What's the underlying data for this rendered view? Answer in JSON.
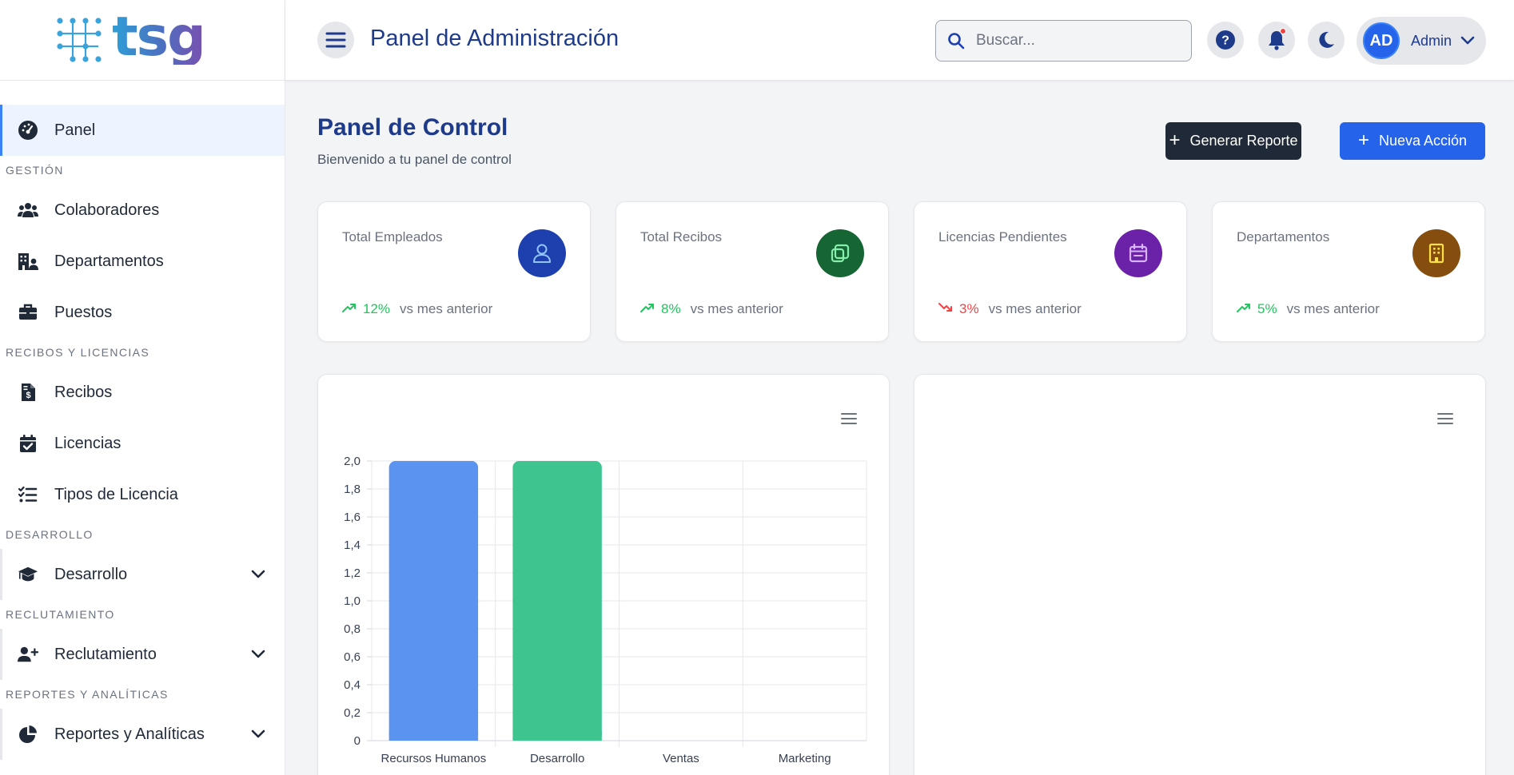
{
  "brand": {
    "logo_text": "tsg"
  },
  "sidebar": {
    "items": [
      {
        "type": "item",
        "label": "Panel",
        "icon": "gauge-icon",
        "active": true
      },
      {
        "type": "section",
        "label": "GESTIÓN"
      },
      {
        "type": "item",
        "label": "Colaboradores",
        "icon": "users-icon"
      },
      {
        "type": "item",
        "label": "Departamentos",
        "icon": "building-user-icon"
      },
      {
        "type": "item",
        "label": "Puestos",
        "icon": "briefcase-icon"
      },
      {
        "type": "section",
        "label": "RECIBOS Y LICENCIAS"
      },
      {
        "type": "item",
        "label": "Recibos",
        "icon": "file-invoice-dollar-icon"
      },
      {
        "type": "item",
        "label": "Licencias",
        "icon": "calendar-check-icon"
      },
      {
        "type": "item",
        "label": "Tipos de Licencia",
        "icon": "list-check-icon"
      },
      {
        "type": "section",
        "label": "DESARROLLO"
      },
      {
        "type": "group",
        "label": "Desarrollo",
        "icon": "graduation-cap-icon"
      },
      {
        "type": "section",
        "label": "RECLUTAMIENTO"
      },
      {
        "type": "group",
        "label": "Reclutamiento",
        "icon": "user-plus-icon"
      },
      {
        "type": "section",
        "label": "REPORTES Y ANALÍTICAS"
      },
      {
        "type": "group",
        "label": "Reportes y Analíticas",
        "icon": "chart-pie-icon"
      }
    ]
  },
  "header": {
    "title": "Panel de Administración",
    "search_placeholder": "Buscar...",
    "user": {
      "initials": "AD",
      "name": "Admin"
    }
  },
  "main": {
    "title": "Panel de Control",
    "subtitle": "Bienvenido a tu panel de control",
    "actions": {
      "report_label": "Generar Reporte",
      "new_action_label": "Nueva Acción"
    },
    "stats": [
      {
        "label": "Total Empleados",
        "trend": "12%",
        "direction": "up",
        "suffix": "vs mes anterior",
        "icon": "user-icon",
        "color": "#1e40af",
        "icon_color": "#93c5fd"
      },
      {
        "label": "Total Recibos",
        "trend": "8%",
        "direction": "up",
        "suffix": "vs mes anterior",
        "icon": "receipt-icon",
        "color": "#166534",
        "icon_color": "#86efac"
      },
      {
        "label": "Licencias Pendientes",
        "trend": "3%",
        "direction": "down",
        "suffix": "vs mes anterior",
        "icon": "calendar-icon",
        "color": "#6b21a8",
        "icon_color": "#d8b4fe"
      },
      {
        "label": "Departamentos",
        "trend": "5%",
        "direction": "up",
        "suffix": "vs mes anterior",
        "icon": "building-icon",
        "color": "#854d0e",
        "icon_color": "#fde047"
      }
    ]
  },
  "chart_data": {
    "type": "bar",
    "categories": [
      "Recursos Humanos",
      "Desarrollo",
      "Ventas",
      "Marketing"
    ],
    "values": [
      2,
      2,
      0,
      0
    ],
    "colors": [
      "#5b93f0",
      "#3ec48f"
    ],
    "ylim": [
      0,
      2
    ],
    "yticks": [
      "0",
      "0,2",
      "0,4",
      "0,6",
      "0,8",
      "1,0",
      "1,2",
      "1,4",
      "1,6",
      "1,8",
      "2,0"
    ],
    "grid": true
  }
}
